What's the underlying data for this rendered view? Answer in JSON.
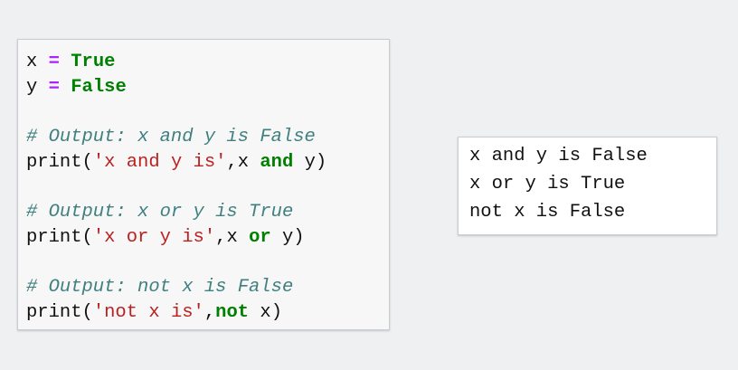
{
  "code_cell": {
    "lines": [
      [
        {
          "t": "x",
          "k": "name"
        },
        {
          "t": " ",
          "k": "punc"
        },
        {
          "t": "=",
          "k": "op"
        },
        {
          "t": " ",
          "k": "punc"
        },
        {
          "t": "True",
          "k": "kw"
        }
      ],
      [
        {
          "t": "y",
          "k": "name"
        },
        {
          "t": " ",
          "k": "punc"
        },
        {
          "t": "=",
          "k": "op"
        },
        {
          "t": " ",
          "k": "punc"
        },
        {
          "t": "False",
          "k": "kw"
        }
      ],
      [],
      [
        {
          "t": "# Output: x and y is False",
          "k": "comment"
        }
      ],
      [
        {
          "t": "print",
          "k": "name"
        },
        {
          "t": "(",
          "k": "punc"
        },
        {
          "t": "'x and y is'",
          "k": "str"
        },
        {
          "t": ",",
          "k": "punc"
        },
        {
          "t": "x ",
          "k": "name"
        },
        {
          "t": "and",
          "k": "kw"
        },
        {
          "t": " y",
          "k": "name"
        },
        {
          "t": ")",
          "k": "punc"
        }
      ],
      [],
      [
        {
          "t": "# Output: x or y is True",
          "k": "comment"
        }
      ],
      [
        {
          "t": "print",
          "k": "name"
        },
        {
          "t": "(",
          "k": "punc"
        },
        {
          "t": "'x or y is'",
          "k": "str"
        },
        {
          "t": ",",
          "k": "punc"
        },
        {
          "t": "x ",
          "k": "name"
        },
        {
          "t": "or",
          "k": "kw"
        },
        {
          "t": " y",
          "k": "name"
        },
        {
          "t": ")",
          "k": "punc"
        }
      ],
      [],
      [
        {
          "t": "# Output: not x is False",
          "k": "comment"
        }
      ],
      [
        {
          "t": "print",
          "k": "name"
        },
        {
          "t": "(",
          "k": "punc"
        },
        {
          "t": "'not x is'",
          "k": "str"
        },
        {
          "t": ",",
          "k": "punc"
        },
        {
          "t": "not",
          "k": "kw"
        },
        {
          "t": " x",
          "k": "name"
        },
        {
          "t": ")",
          "k": "punc"
        }
      ]
    ]
  },
  "output_cell": {
    "lines": [
      "x and y is False",
      "x or y is True",
      "not x is False"
    ]
  },
  "colors": {
    "keyword": "#008000",
    "operator": "#aa22ff",
    "string": "#ba2121",
    "comment": "#408080",
    "background": "#eef0f2"
  }
}
